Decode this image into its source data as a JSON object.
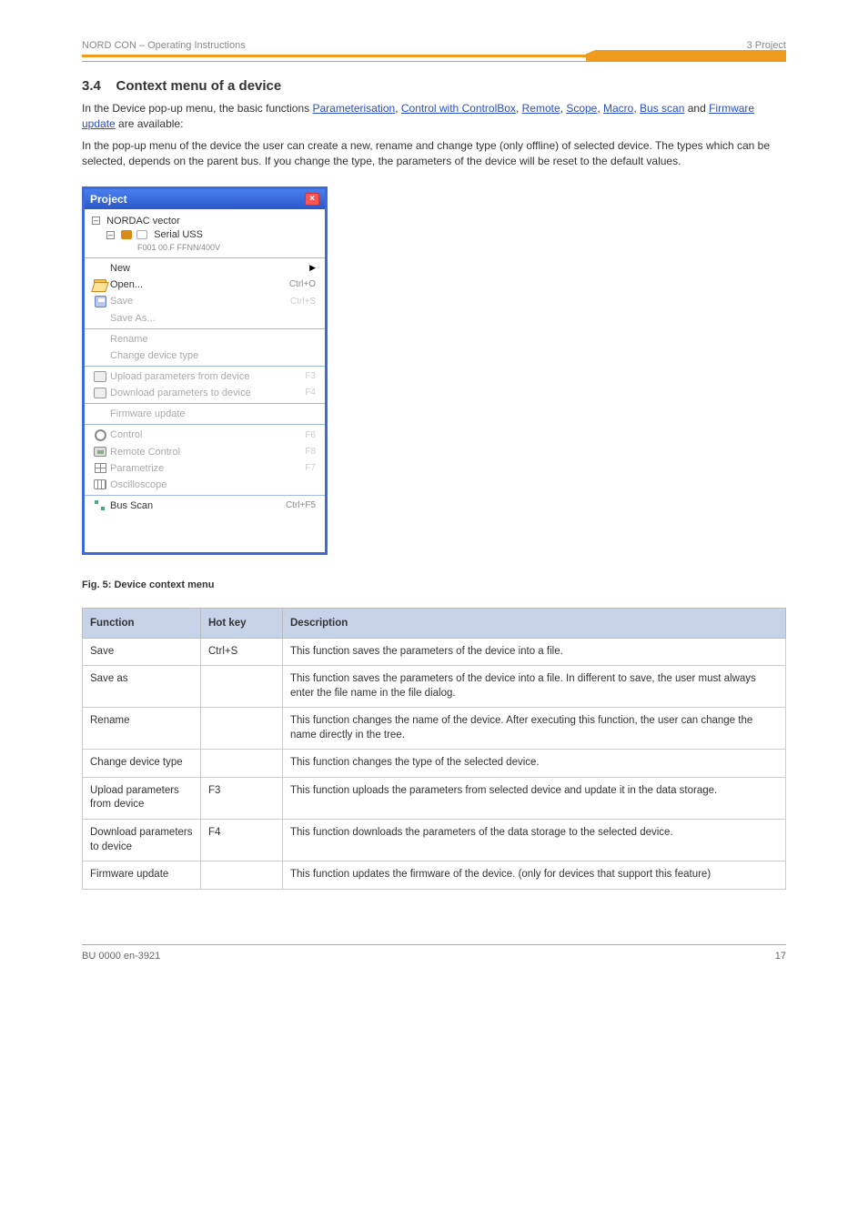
{
  "header": {
    "doc_ref": "NORD CON – Operating Instructions",
    "chapter": "3 Project"
  },
  "section": {
    "number": "3.4",
    "title": "Context menu of a device"
  },
  "body": {
    "p1_pre": "In the Device pop-up menu, the basic functions ",
    "p1_post": " are available:",
    "links": [
      "Parameterisation",
      "Control with ControlBox",
      "Remote",
      "Scope",
      "Macro",
      "Bus scan",
      "Firmware update"
    ],
    "p2": "In the pop-up menu of the device the user can create a new, rename and change type (only offline) of selected device. The types which can be selected, depends on the parent bus. If you change the type, the parameters of the device will be reset to the default values.",
    "caption": "Fig. 5: Device context menu"
  },
  "screenshot": {
    "title": "Project",
    "tree": {
      "root": "NORDAC vector",
      "child": "Serial USS",
      "leaf_hint": "F001 00.F  FFNN/400V"
    },
    "menu": [
      {
        "group": 0,
        "label": "New",
        "shortcut": "",
        "submenu": true,
        "enabled": true,
        "icon": null
      },
      {
        "group": 0,
        "label": "Open...",
        "shortcut": "Ctrl+O",
        "enabled": true,
        "icon": "folder"
      },
      {
        "group": 0,
        "label": "Save",
        "shortcut": "Ctrl+S",
        "enabled": false,
        "icon": "disk"
      },
      {
        "group": 0,
        "label": "Save As...",
        "shortcut": "",
        "enabled": false,
        "icon": null
      },
      {
        "group": 1,
        "label": "Rename",
        "shortcut": "",
        "enabled": false,
        "icon": null
      },
      {
        "group": 1,
        "label": "Change device type",
        "shortcut": "",
        "enabled": false,
        "icon": null
      },
      {
        "group": 2,
        "label": "Upload parameters from device",
        "shortcut": "F3",
        "enabled": false,
        "icon": "transfer"
      },
      {
        "group": 2,
        "label": "Download parameters to device",
        "shortcut": "F4",
        "enabled": false,
        "icon": "transfer"
      },
      {
        "group": 3,
        "label": "Firmware update",
        "shortcut": "",
        "enabled": false,
        "icon": null
      },
      {
        "group": 4,
        "label": "Control",
        "shortcut": "F6",
        "enabled": false,
        "icon": "gear"
      },
      {
        "group": 4,
        "label": "Remote Control",
        "shortcut": "F8",
        "enabled": false,
        "icon": "remote"
      },
      {
        "group": 4,
        "label": "Parametrize",
        "shortcut": "F7",
        "enabled": false,
        "icon": "grid"
      },
      {
        "group": 4,
        "label": "Oscilloscope",
        "shortcut": "",
        "enabled": false,
        "icon": "scope"
      },
      {
        "group": 5,
        "label": "Bus Scan",
        "shortcut": "Ctrl+F5",
        "enabled": true,
        "icon": "scan"
      }
    ]
  },
  "table": {
    "headers": [
      "Function",
      "Hot key",
      "Description"
    ],
    "rows": [
      {
        "func": "Save",
        "key": "Ctrl+S",
        "desc": "This function saves the parameters of the device into a file."
      },
      {
        "func": "Save as",
        "key": "",
        "desc": "This function saves the parameters of the device into a file. In different to save, the user must always enter the file name in the file dialog."
      },
      {
        "func": "Rename",
        "key": "",
        "desc": "This function changes the name of the device. After executing this function, the user can change the name directly in the tree."
      },
      {
        "func": "Change device type",
        "key": "",
        "desc": "This function changes the type of the selected device."
      },
      {
        "func": "Upload parameters from device",
        "key": "F3",
        "desc": "This function uploads the parameters from selected device and update it in the data storage."
      },
      {
        "func": "Download parameters to device",
        "key": "F4",
        "desc": "This function downloads the parameters of the data storage to the selected device."
      },
      {
        "func": "Firmware update",
        "key": "",
        "desc": "This function updates the firmware of the device. (only for devices that support this feature)"
      }
    ]
  },
  "footer": {
    "left": "BU 0000 en-3921",
    "right": "17"
  }
}
